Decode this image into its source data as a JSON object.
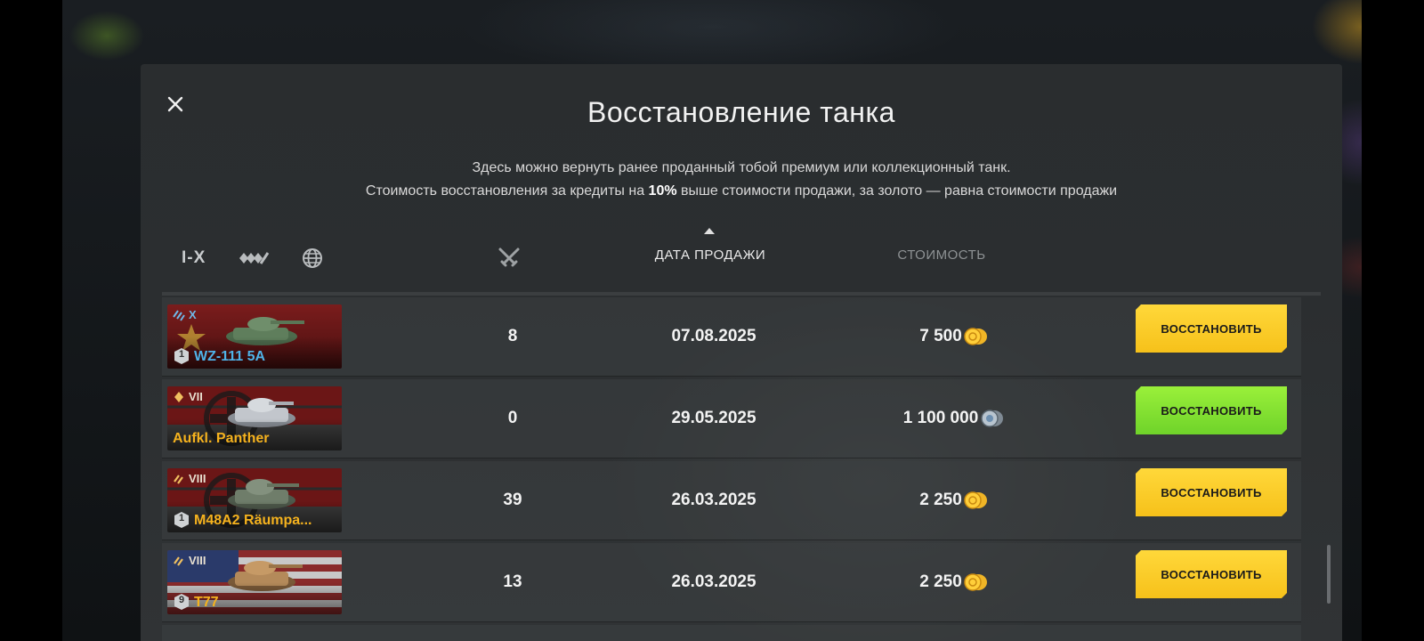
{
  "title": "Восстановление танка",
  "description": {
    "line1": "Здесь можно вернуть ранее проданный тобой премиум или коллекционный танк.",
    "line2_before": "Стоимость восстановления за кредиты на ",
    "line2_bold": "10%",
    "line2_after": " выше стоимости продажи, за золото — равна стоимости продажи"
  },
  "filters": {
    "tier_label": "I-X",
    "type_icon": "vehicle-type-icon",
    "nation_icon": "globe-icon"
  },
  "columns": {
    "battles_icon": "crossed-swords-icon",
    "sale_date": "ДАТА ПРОДАЖИ",
    "cost": "СТОИМОСТЬ",
    "sort_column": "sale_date"
  },
  "colors": {
    "gold_button": "#f6c11a",
    "credit_button": "#6fd32a",
    "premium_name": "#f5b21e",
    "collector_name": "#4fb3e8"
  },
  "rows": [
    {
      "nation": "china",
      "tier": "X",
      "tier_color": "#6fb8e8",
      "mastery": "1",
      "name": "WZ-111 5A",
      "name_color": "#4fb3e8",
      "battles": "8",
      "date": "07.08.2025",
      "cost": "7 500",
      "currency": "gold",
      "button": "ВОССТАНОВИТЬ"
    },
    {
      "nation": "germany",
      "tier": "VII",
      "tier_color": "#f0c060",
      "mastery": "",
      "name": "Aufkl. Panther",
      "name_color": "#f5b21e",
      "battles": "0",
      "date": "29.05.2025",
      "cost": "1 100 000",
      "currency": "credits",
      "button": "ВОССТАНОВИТЬ"
    },
    {
      "nation": "germany",
      "tier": "VIII",
      "tier_color": "#f0c060",
      "mastery": "1",
      "name": "M48A2 Räumpa...",
      "name_color": "#f5b21e",
      "battles": "39",
      "date": "26.03.2025",
      "cost": "2 250",
      "currency": "gold",
      "button": "ВОССТАНОВИТЬ"
    },
    {
      "nation": "usa",
      "tier": "VIII",
      "tier_color": "#f0c060",
      "mastery": "9",
      "name": "T77",
      "name_color": "#f5b21e",
      "battles": "13",
      "date": "26.03.2025",
      "cost": "2 250",
      "currency": "gold",
      "button": "ВОССТАНОВИТЬ"
    }
  ]
}
